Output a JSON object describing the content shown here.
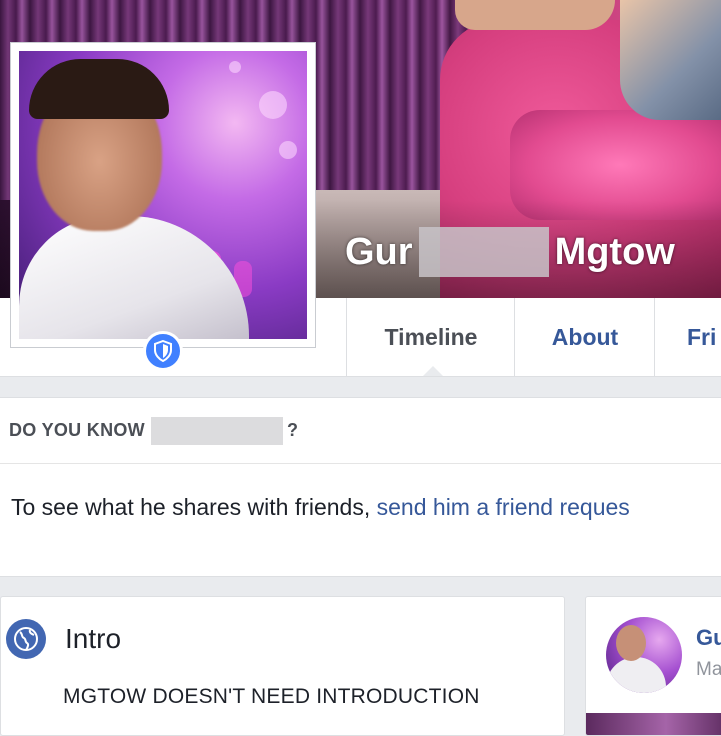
{
  "profile": {
    "name_first": "Gur",
    "name_last": "Mgtow"
  },
  "tabs": [
    {
      "label": "Timeline"
    },
    {
      "label": "About"
    },
    {
      "label": "Fri"
    }
  ],
  "do_you_know": {
    "title": "DO YOU KNOW",
    "question_mark": "?",
    "body_text": "To see what he shares with friends, ",
    "link_text": "send him a friend reques"
  },
  "intro": {
    "title": "Intro",
    "text": "MGTOW DOESN'T NEED INTRODUCTION"
  },
  "side_card": {
    "name": "Gu",
    "sub": "Ma"
  },
  "colors": {
    "link": "#365899",
    "badge": "#4080ff",
    "globe": "#4267b2"
  }
}
